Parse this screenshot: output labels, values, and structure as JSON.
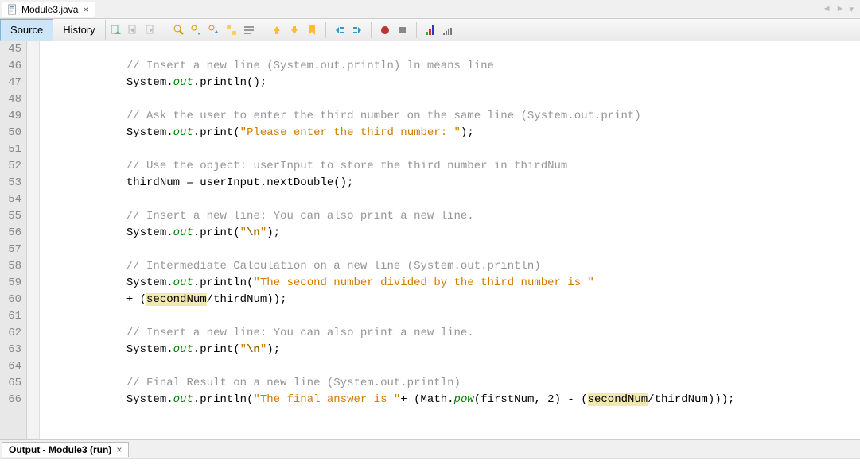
{
  "tab": {
    "fileName": "Module3.java"
  },
  "views": {
    "source": "Source",
    "history": "History"
  },
  "output": {
    "title": "Output - Module3 (run)"
  },
  "code": {
    "startLine": 45,
    "lines": [
      {
        "n": 45,
        "t": "blank"
      },
      {
        "n": 46,
        "t": "comment",
        "indent": "            ",
        "text": "// Insert a new line (System.out.println) ln means line"
      },
      {
        "n": 47,
        "t": "call",
        "indent": "            ",
        "prefix": "System.",
        "kw": "out",
        "after": ".println();"
      },
      {
        "n": 48,
        "t": "blank"
      },
      {
        "n": 49,
        "t": "comment",
        "indent": "            ",
        "text": "// Ask the user to enter the third number on the same line (System.out.print)"
      },
      {
        "n": 50,
        "t": "callstr",
        "indent": "            ",
        "prefix": "System.",
        "kw": "out",
        "mid": ".print(",
        "str": "\"Please enter the third number: \"",
        "end": ");"
      },
      {
        "n": 51,
        "t": "blank"
      },
      {
        "n": 52,
        "t": "comment",
        "indent": "            ",
        "text": "// Use the object: userInput to store the third number in thirdNum"
      },
      {
        "n": 53,
        "t": "plain",
        "indent": "            ",
        "text": "thirdNum = userInput.nextDouble();"
      },
      {
        "n": 54,
        "t": "blank"
      },
      {
        "n": 55,
        "t": "comment",
        "indent": "            ",
        "text": "// Insert a new line: You can also print a new line."
      },
      {
        "n": 56,
        "t": "nlprint",
        "indent": "            "
      },
      {
        "n": 57,
        "t": "blank"
      },
      {
        "n": 58,
        "t": "comment",
        "indent": "            ",
        "text": "// Intermediate Calculation on a new line (System.out.println)"
      },
      {
        "n": 59,
        "t": "callstr",
        "indent": "            ",
        "prefix": "System.",
        "kw": "out",
        "mid": ".println(",
        "str": "\"The second number divided by the third number is \"",
        "end": ""
      },
      {
        "n": 60,
        "t": "hl1",
        "indent": "            "
      },
      {
        "n": 61,
        "t": "blank"
      },
      {
        "n": 62,
        "t": "comment",
        "indent": "            ",
        "text": "// Insert a new line: You can also print a new line."
      },
      {
        "n": 63,
        "t": "nlprint",
        "indent": "            "
      },
      {
        "n": 64,
        "t": "blank"
      },
      {
        "n": 65,
        "t": "comment",
        "indent": "            ",
        "text": "// Final Result on a new line (System.out.println)"
      },
      {
        "n": 66,
        "t": "hl2",
        "indent": "            "
      }
    ]
  }
}
